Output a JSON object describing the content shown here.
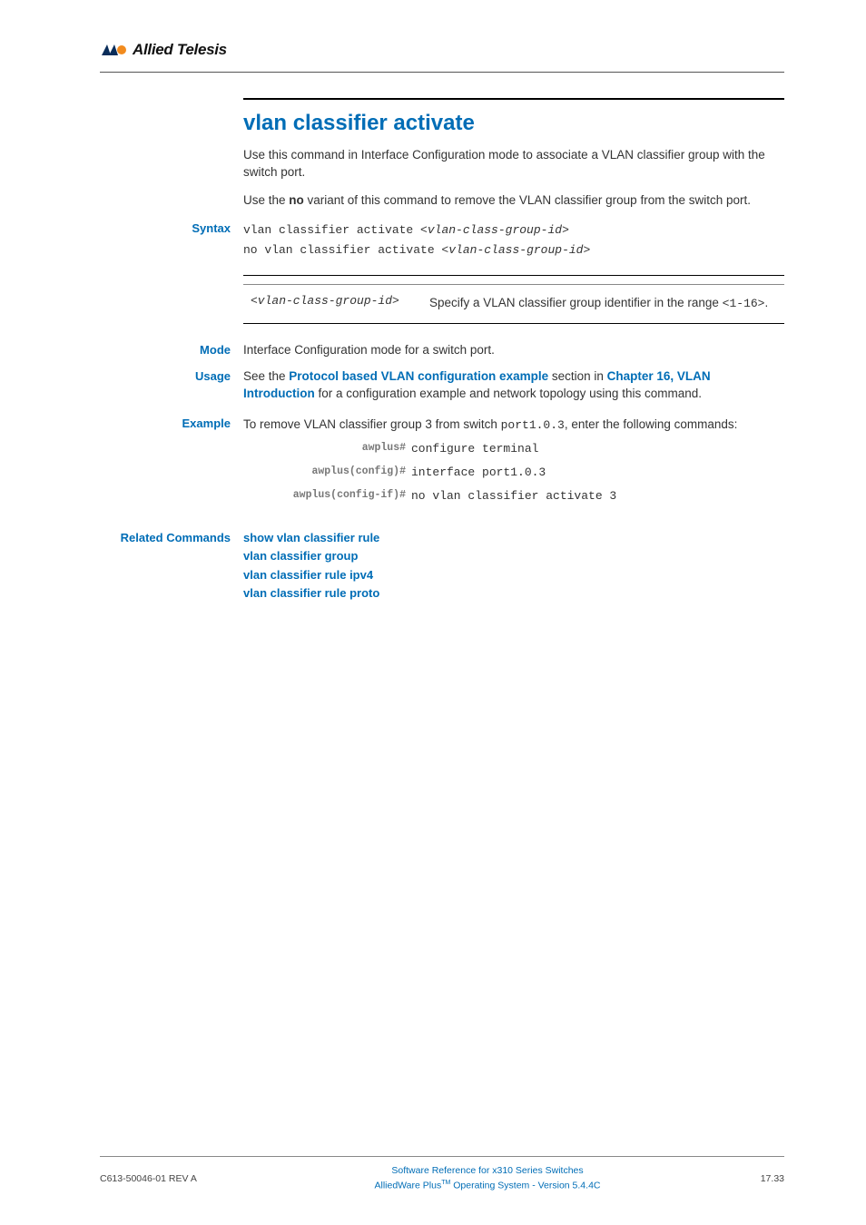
{
  "header": {
    "brand": "Allied Telesis"
  },
  "command": {
    "title": "vlan classifier activate",
    "intro1": "Use this command in Interface Configuration mode to associate a VLAN classifier group with the switch port.",
    "intro2_prefix": "Use the ",
    "intro2_bold": "no",
    "intro2_suffix": " variant of this command to remove the VLAN classifier group from the switch port."
  },
  "syntax": {
    "label": "Syntax",
    "line1_a": "vlan classifier activate <",
    "line1_b": "vlan-class-group-id",
    "line1_c": ">",
    "line2_a": "no vlan classifier activate <",
    "line2_b": "vlan-class-group-id",
    "line2_c": ">"
  },
  "params": {
    "p1_name": "<vlan-class-group-id>",
    "p1_desc_a": "Specify a VLAN classifier group identifier in the range ",
    "p1_desc_b": "<1-16>",
    "p1_desc_c": "."
  },
  "mode": {
    "label": "Mode",
    "text": "Interface Configuration mode for a switch port."
  },
  "usage": {
    "label": "Usage",
    "a": "See the ",
    "link1": "Protocol based VLAN configuration example",
    "b": " section in ",
    "link2": "Chapter 16, VLAN Introduction",
    "c": " for a configuration example and network topology using this command."
  },
  "example": {
    "label": "Example",
    "intro_a": "To remove VLAN classifier group 3 from switch ",
    "intro_b": "port1.0.3",
    "intro_c": ", enter the following commands:",
    "rows": [
      {
        "prompt": "awplus#",
        "cmd": "configure terminal"
      },
      {
        "prompt": "awplus(config)#",
        "cmd": "interface port1.0.3"
      },
      {
        "prompt": "awplus(config-if)#",
        "cmd": "no vlan classifier activate 3"
      }
    ]
  },
  "related": {
    "label": "Related Commands",
    "items": [
      "show vlan classifier rule",
      "vlan classifier group",
      "vlan classifier rule ipv4",
      "vlan classifier rule proto"
    ]
  },
  "footer": {
    "left": "C613-50046-01 REV A",
    "center1": "Software Reference for x310 Series Switches",
    "center2_a": "AlliedWare Plus",
    "center2_b": "TM",
    "center2_c": " Operating System - Version 5.4.4C",
    "right": "17.33"
  }
}
